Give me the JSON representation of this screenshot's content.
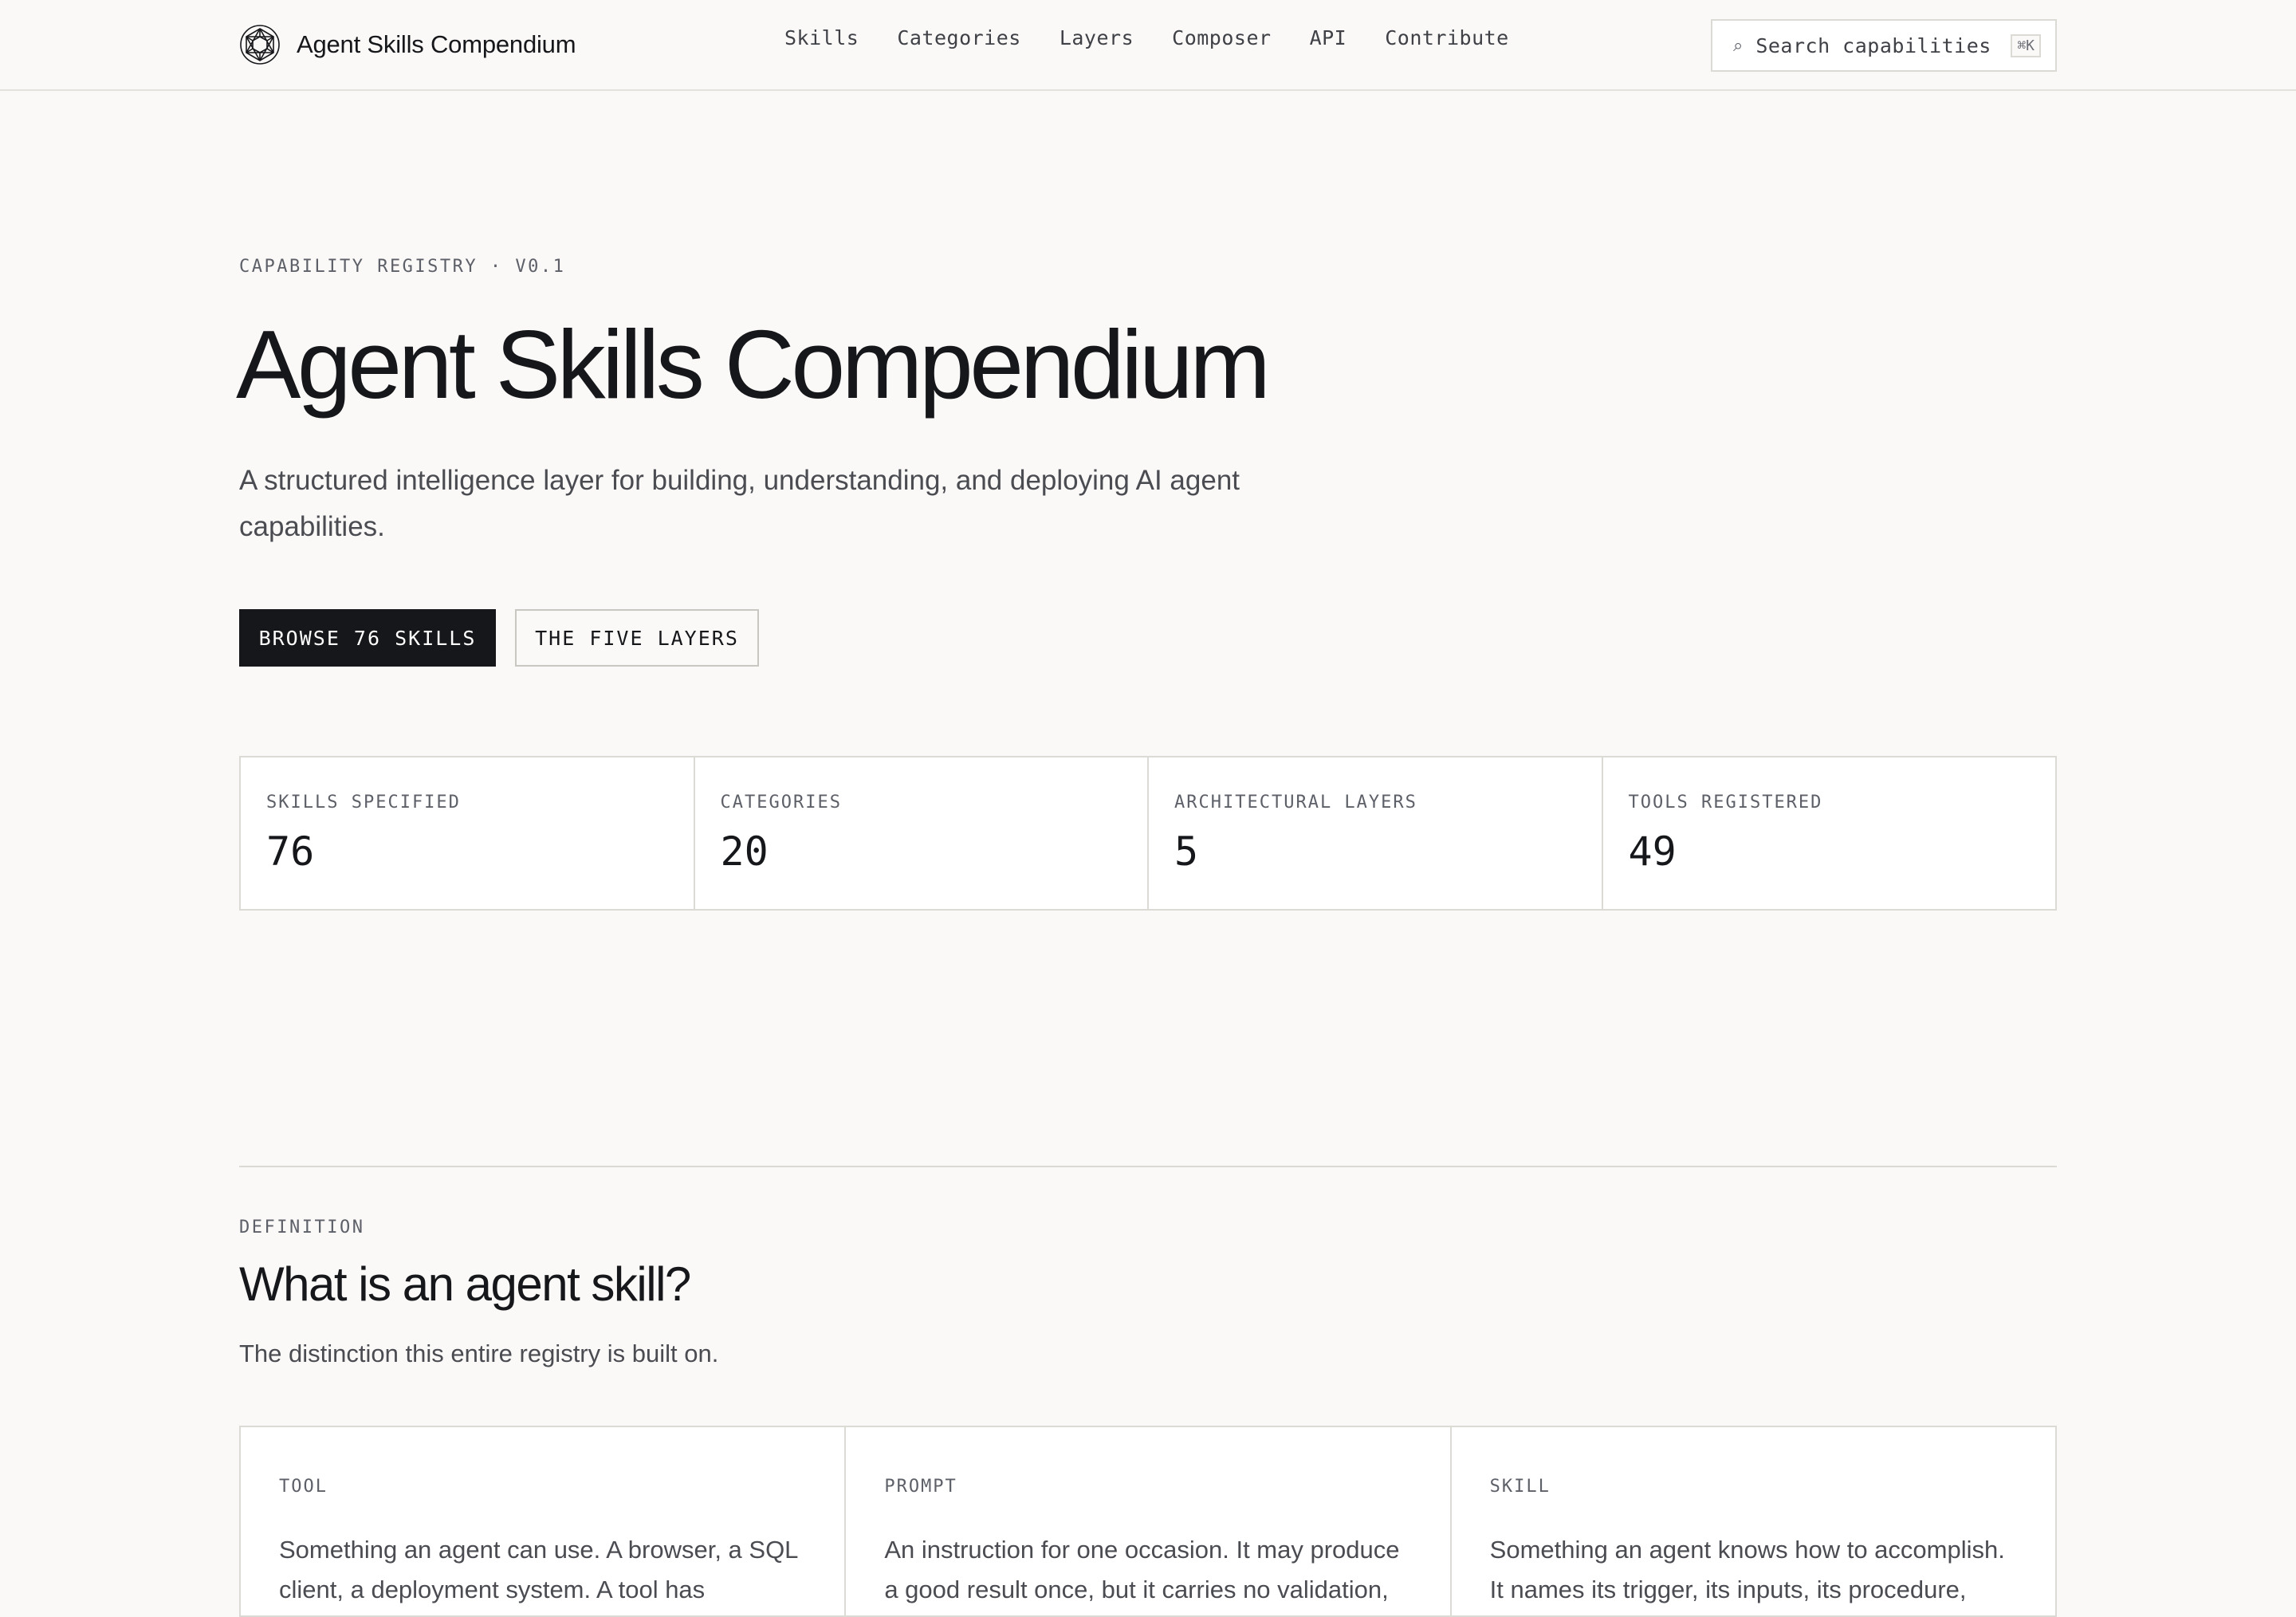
{
  "colors": {
    "background": "#faf9f7",
    "ink": "#16171a",
    "muted": "#5d6068",
    "border": "#dcdad4",
    "primary_button": "#16171a"
  },
  "header": {
    "brand_name": "Agent Skills Compendium",
    "logo_icon": "geodesic-sphere-icon",
    "nav": [
      "Skills",
      "Categories",
      "Layers",
      "Composer",
      "API",
      "Contribute"
    ],
    "search": {
      "icon": "search-icon",
      "placeholder": "Search capabilities",
      "shortcut": "⌘K"
    }
  },
  "hero": {
    "eyebrow": "CAPABILITY REGISTRY · V0.1",
    "title": "Agent Skills Compendium",
    "subtitle": "A structured intelligence layer for building, understanding, and deploying AI agent capabilities.",
    "primary_cta": "BROWSE 76 SKILLS",
    "secondary_cta": "THE FIVE LAYERS"
  },
  "stats": [
    {
      "label": "SKILLS SPECIFIED",
      "value": "76"
    },
    {
      "label": "CATEGORIES",
      "value": "20"
    },
    {
      "label": "ARCHITECTURAL LAYERS",
      "value": "5"
    },
    {
      "label": "TOOLS REGISTERED",
      "value": "49"
    }
  ],
  "definition": {
    "eyebrow": "DEFINITION",
    "title": "What is an agent skill?",
    "subtitle": "The distinction this entire registry is built on.",
    "cards": [
      {
        "label": "TOOL",
        "text": "Something an agent can use. A browser, a SQL client, a deployment system. A tool has"
      },
      {
        "label": "PROMPT",
        "text": "An instruction for one occasion. It may produce a good result once, but it carries no validation,"
      },
      {
        "label": "SKILL",
        "text": "Something an agent knows how to accomplish. It names its trigger, its inputs, its procedure,"
      }
    ]
  }
}
